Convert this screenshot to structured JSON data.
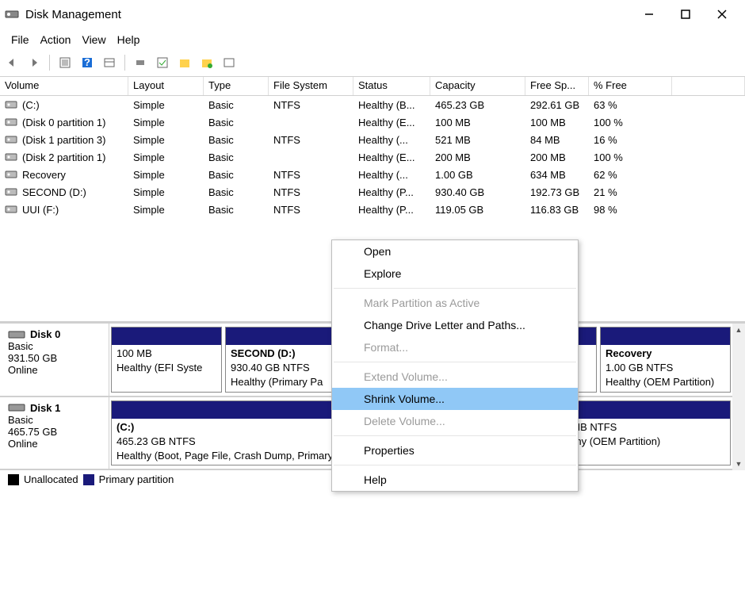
{
  "window": {
    "title": "Disk Management"
  },
  "menus": {
    "file": "File",
    "action": "Action",
    "view": "View",
    "help": "Help"
  },
  "columns": {
    "volume": "Volume",
    "layout": "Layout",
    "type": "Type",
    "fs": "File System",
    "status": "Status",
    "capacity": "Capacity",
    "free": "Free Sp...",
    "pct": "% Free"
  },
  "volumes": [
    {
      "name": " (C:)",
      "layout": "Simple",
      "type": "Basic",
      "fs": "NTFS",
      "status": "Healthy (B...",
      "capacity": "465.23 GB",
      "free": "292.61 GB",
      "pct": "63 %"
    },
    {
      "name": " (Disk 0 partition 1)",
      "layout": "Simple",
      "type": "Basic",
      "fs": "",
      "status": "Healthy (E...",
      "capacity": "100 MB",
      "free": "100 MB",
      "pct": "100 %"
    },
    {
      "name": " (Disk 1 partition 3)",
      "layout": "Simple",
      "type": "Basic",
      "fs": "NTFS",
      "status": "Healthy (...",
      "capacity": "521 MB",
      "free": "84 MB",
      "pct": "16 %"
    },
    {
      "name": " (Disk 2 partition 1)",
      "layout": "Simple",
      "type": "Basic",
      "fs": "",
      "status": "Healthy (E...",
      "capacity": "200 MB",
      "free": "200 MB",
      "pct": "100 %"
    },
    {
      "name": " Recovery",
      "layout": "Simple",
      "type": "Basic",
      "fs": "NTFS",
      "status": "Healthy (...",
      "capacity": "1.00 GB",
      "free": "634 MB",
      "pct": "62 %"
    },
    {
      "name": " SECOND (D:)",
      "layout": "Simple",
      "type": "Basic",
      "fs": "NTFS",
      "status": "Healthy (P...",
      "capacity": "930.40 GB",
      "free": "192.73 GB",
      "pct": "21 %"
    },
    {
      "name": " UUI (F:)",
      "layout": "Simple",
      "type": "Basic",
      "fs": "NTFS",
      "status": "Healthy (P...",
      "capacity": "119.05 GB",
      "free": "116.83 GB",
      "pct": "98 %"
    }
  ],
  "disks": {
    "d0": {
      "name": "Disk 0",
      "type": "Basic",
      "size": "931.50 GB",
      "status": "Online",
      "parts": [
        {
          "title": "",
          "line1": "100 MB",
          "line2": "Healthy (EFI Syste"
        },
        {
          "title": "SECOND  (D:)",
          "line1": "930.40 GB NTFS",
          "line2": "Healthy (Primary Pa"
        },
        {
          "title": "Recovery",
          "line1": "1.00 GB NTFS",
          "line2": "Healthy (OEM Partition)"
        }
      ]
    },
    "d1": {
      "name": "Disk 1",
      "type": "Basic",
      "size": "465.75 GB",
      "status": "Online",
      "parts": [
        {
          "title": " (C:)",
          "line1": "465.23 GB NTFS",
          "line2": "Healthy (Boot, Page File, Crash Dump, Primary Partition)"
        },
        {
          "title": "",
          "line1": "521 MB NTFS",
          "line2": "Healthy (OEM Partition)"
        }
      ]
    }
  },
  "legend": {
    "unallocated": "Unallocated",
    "primary": "Primary partition"
  },
  "context_menu": {
    "open": "Open",
    "explore": "Explore",
    "mark_active": "Mark Partition as Active",
    "change_letter": "Change Drive Letter and Paths...",
    "format": "Format...",
    "extend": "Extend Volume...",
    "shrink": "Shrink Volume...",
    "delete": "Delete Volume...",
    "properties": "Properties",
    "help": "Help"
  }
}
